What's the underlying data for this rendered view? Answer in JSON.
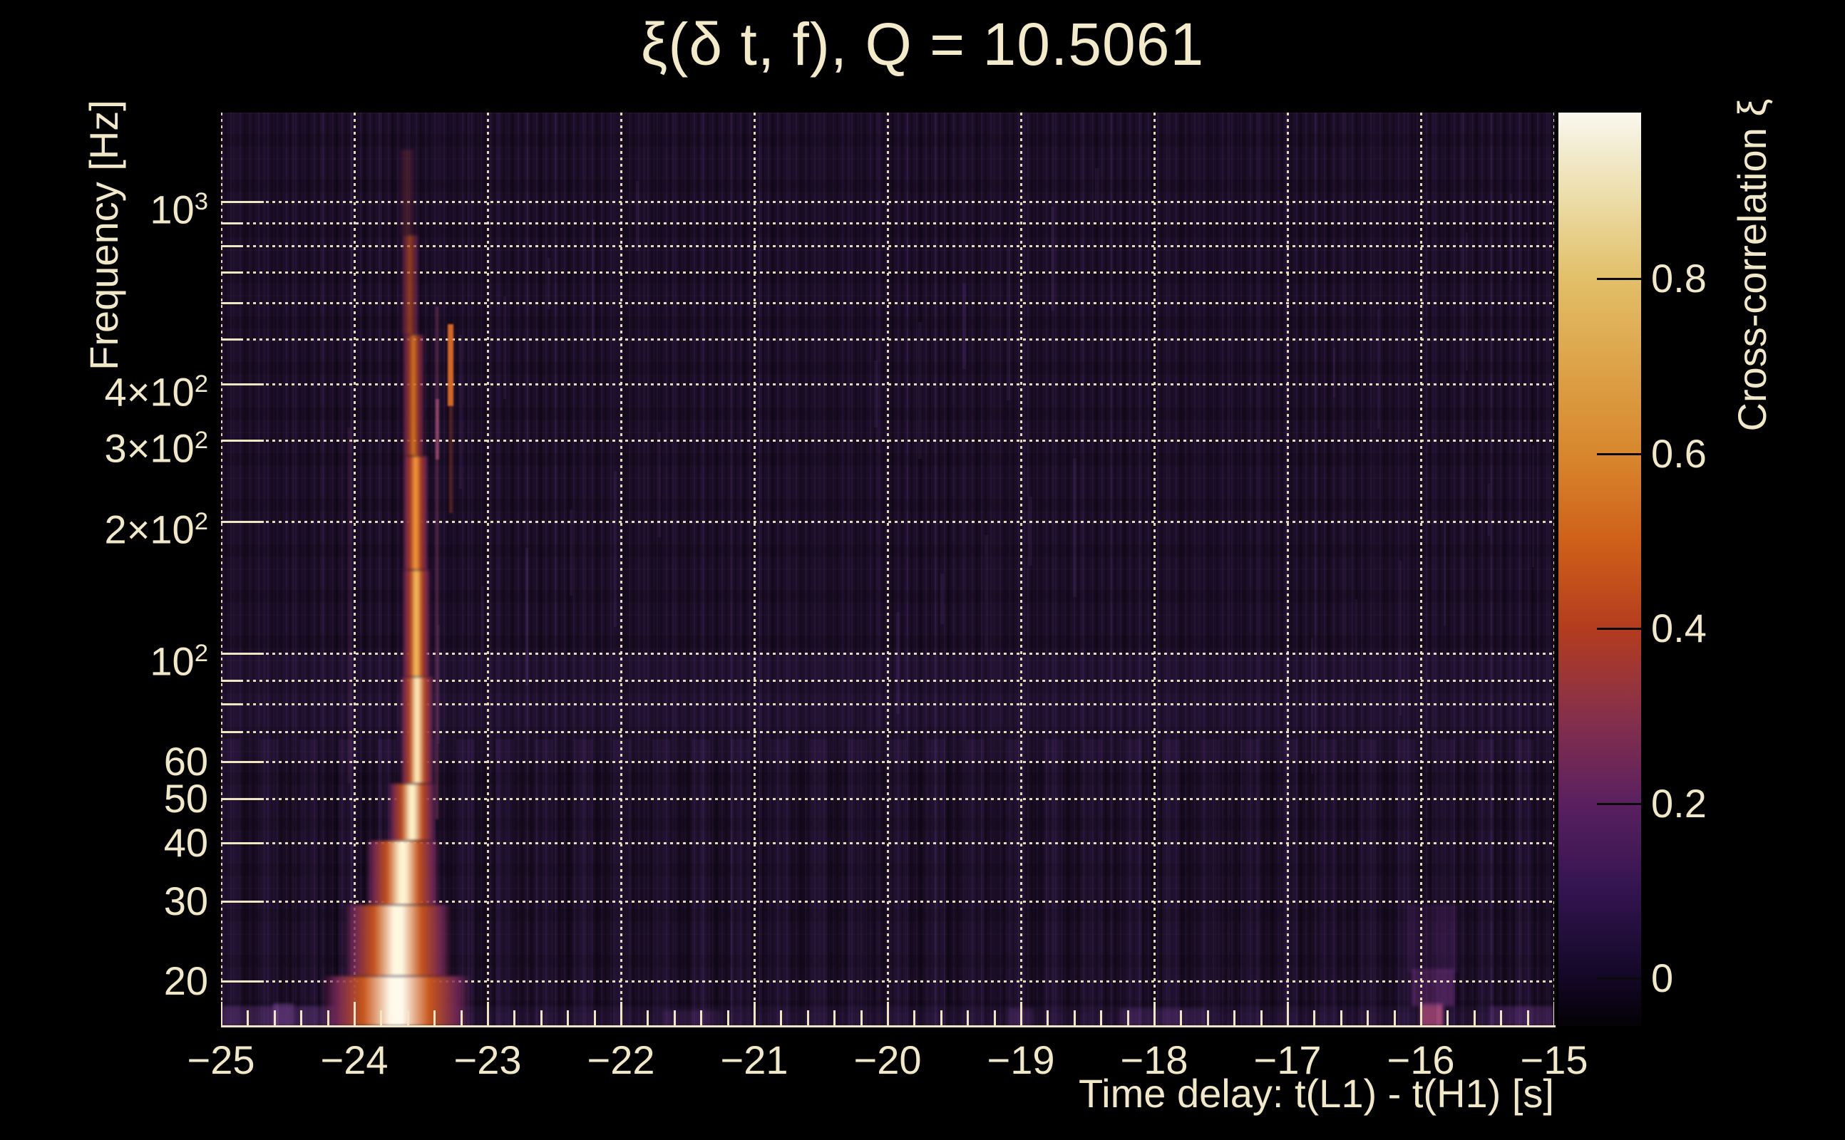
{
  "title": "ξ(δ t, f), Q = 10.5061",
  "axes": {
    "x": {
      "title": "Time delay: t(L1) - t(H1) [s]",
      "tick_labels": [
        "−25",
        "−24",
        "−23",
        "−22",
        "−21",
        "−20",
        "−19",
        "−18",
        "−17",
        "−16",
        "−15"
      ]
    },
    "y": {
      "title": "Frequency [Hz]",
      "tick_bases": [
        "10",
        "4×10",
        "3×10",
        "2×10",
        "10",
        "60",
        "50",
        "40",
        "30",
        "20"
      ],
      "tick_exps": [
        "3",
        "2",
        "2",
        "2",
        "2",
        "",
        "",
        "",
        "",
        ""
      ]
    }
  },
  "colorbar": {
    "title": "Cross-correlation ξ",
    "tick_labels": [
      "0.8",
      "0.6",
      "0.4",
      "0.2",
      "0"
    ]
  },
  "chart_data": {
    "type": "heatmap",
    "title": "ξ(δ t, f), Q = 10.5061",
    "q_value": 10.5061,
    "xlabel": "Time delay: t(L1) - t(H1) [s]",
    "ylabel": "Frequency [Hz]",
    "colorbar_label": "Cross-correlation ξ",
    "x_range_s": [
      -25,
      -15
    ],
    "x_major_tick_step_s": 1,
    "x_minor_tick_step_s": 0.2,
    "y_scale": "log",
    "y_range_hz": [
      16,
      1600
    ],
    "y_labeled_ticks_hz": [
      1000,
      400,
      300,
      200,
      100,
      60,
      50,
      40,
      30,
      20
    ],
    "y_gridlines_hz": [
      1000,
      900,
      800,
      700,
      600,
      500,
      400,
      300,
      200,
      100,
      90,
      80,
      70,
      60,
      50,
      40,
      30,
      20
    ],
    "grid": "dotted cream gridlines on both axes over dark background",
    "legend": "vertical colorbar at right",
    "colorbar_range": [
      -0.05,
      1.0
    ],
    "colorbar_ticks": [
      0.8,
      0.6,
      0.4,
      0.2,
      0
    ],
    "colormap": "inferno-like: near-black purple → violet → red-orange → amber → cream white",
    "colormap_stops": [
      {
        "value": 1.0,
        "color": "#faf7ee"
      },
      {
        "value": 0.95,
        "color": "#f3ecd2"
      },
      {
        "value": 0.9,
        "color": "#eddfae"
      },
      {
        "value": 0.85,
        "color": "#e7cf8a"
      },
      {
        "value": 0.8,
        "color": "#e2bf69"
      },
      {
        "value": 0.7,
        "color": "#dda348"
      },
      {
        "value": 0.6,
        "color": "#d8872e"
      },
      {
        "value": 0.5,
        "color": "#cf6019"
      },
      {
        "value": 0.4,
        "color": "#b43c1f"
      },
      {
        "value": 0.3,
        "color": "#87304a"
      },
      {
        "value": 0.2,
        "color": "#5a2060"
      },
      {
        "value": 0.1,
        "color": "#33144f"
      },
      {
        "value": 0.05,
        "color": "#220e3a"
      },
      {
        "value": 0.0,
        "color": "#130726"
      },
      {
        "value": -0.05,
        "color": "#050208"
      }
    ],
    "features": [
      {
        "name": "chirp-track",
        "time_delay_s": -23.6,
        "frequency_span_hz": [
          16,
          900
        ],
        "peak_cross_correlation": 1.0,
        "description": "Bright chirp: broad cream-white base spanning ~16–60 Hz near t ≈ −23.65 s, narrowing upward into a thin yellow-orange streak near t ≈ −23.53 s that fades above ~600–900 Hz"
      },
      {
        "name": "secondary-orange-streak",
        "time_delay_s": -23.28,
        "frequency_span_hz": [
          250,
          420
        ],
        "peak_cross_correlation": 0.45,
        "description": "Short faint orange vertical dash to the right of the main chirp"
      },
      {
        "name": "faint-pink-streak",
        "time_delay_s": -23.38,
        "frequency_span_hz": [
          60,
          400
        ],
        "peak_cross_correlation": 0.25,
        "description": "Very faint thin pink streak parallel to the chirp"
      },
      {
        "name": "low-frequency-magenta-blip",
        "time_delay_s": -16.0,
        "frequency_span_hz": [
          16,
          20
        ],
        "peak_cross_correlation": 0.35,
        "description": "Small magenta patch at the bottom edge near −16 s"
      },
      {
        "name": "noise-texture",
        "typical_value_range": [
          0.0,
          0.1
        ],
        "description": "Fine vertical purple noise striations across the whole map; time bins become coarser toward low frequency"
      }
    ]
  }
}
